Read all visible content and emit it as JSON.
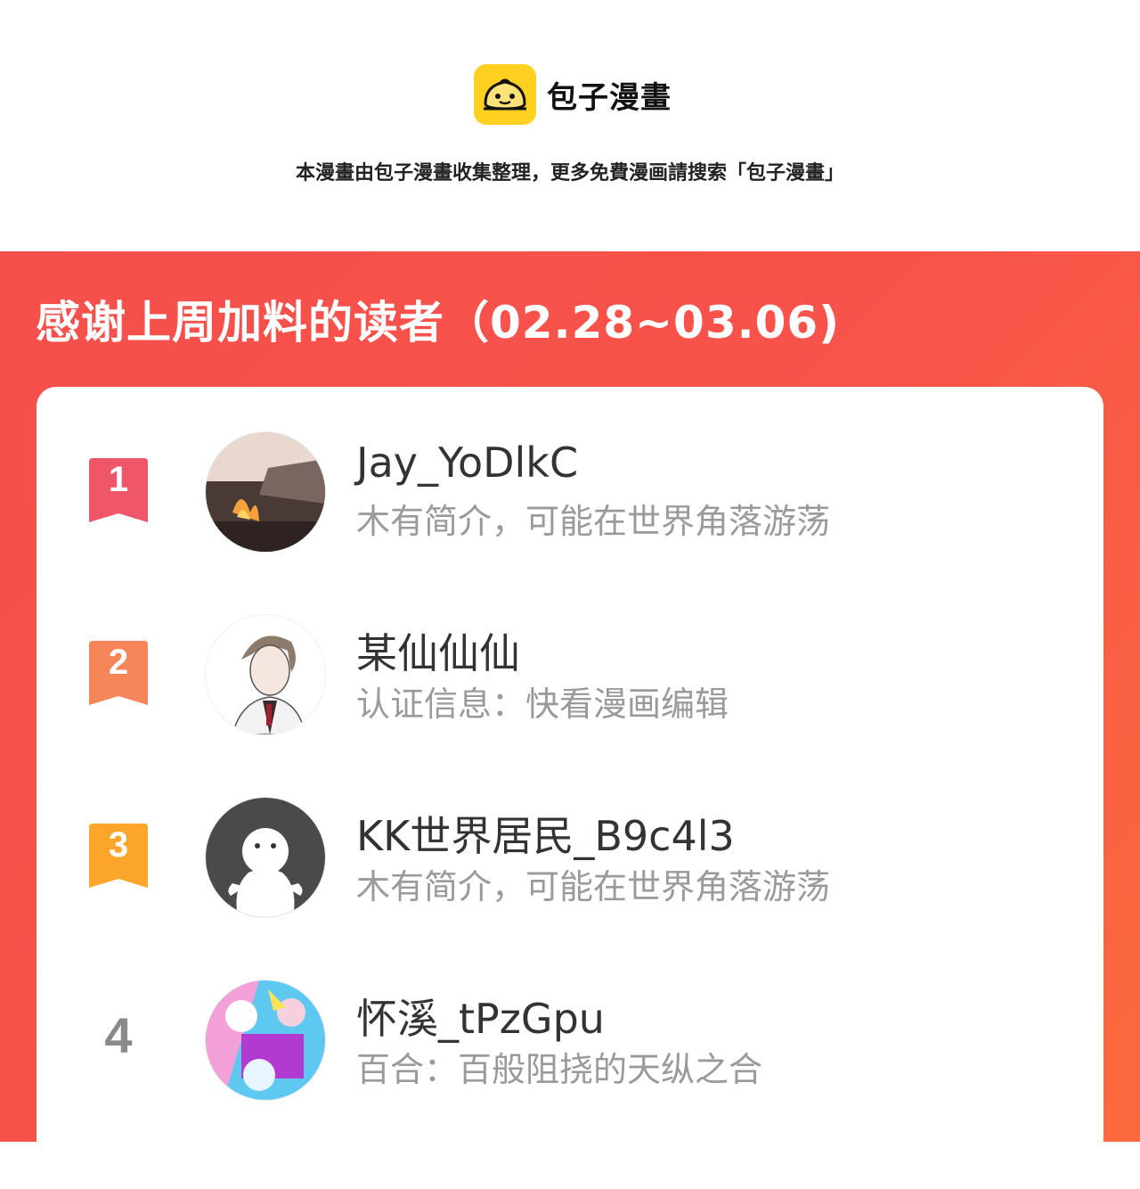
{
  "brand": {
    "name": "包子漫畫",
    "logo_color": "#ffd020",
    "tagline": "本漫畫由包子漫畫收集整理，更多免費漫画請搜索「包子漫畫」"
  },
  "panel": {
    "title": "感谢上周加料的读者（02.28~03.06)",
    "gradient_start": "#f54f4c",
    "gradient_end": "#fb6a3d"
  },
  "readers": [
    {
      "rank": "1",
      "name": "Jay_YoDlkC",
      "desc": "木有简介，可能在世界角落游荡",
      "badge_color": "#f0566a",
      "avatar": "campfire-photo-avatar"
    },
    {
      "rank": "2",
      "name": "某仙仙仙",
      "desc": "认证信息：快看漫画编辑",
      "badge_color": "#f7855a",
      "avatar": "illustrated-man-avatar"
    },
    {
      "rank": "3",
      "name": "KK世界居民_B9c4l3",
      "desc": "木有简介，可能在世界角落游荡",
      "badge_color": "#fba52a",
      "avatar": "default-ghost-avatar"
    },
    {
      "rank": "4",
      "name": "怀溪_tPzGpu",
      "desc": "百合：百般阻挠的天纵之合",
      "badge_color": "#8a8a8a",
      "avatar": "anime-characters-avatar"
    }
  ]
}
